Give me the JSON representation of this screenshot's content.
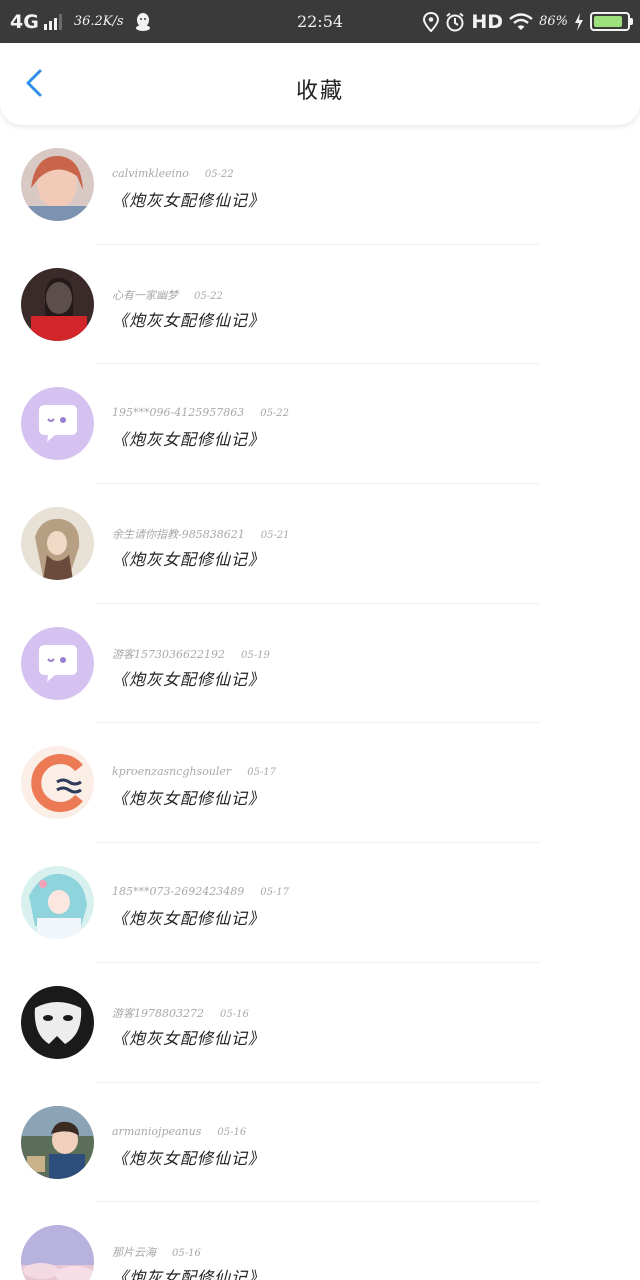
{
  "status_bar": {
    "network": "4G",
    "speed": "36.2K/s",
    "time": "22:54",
    "hd": "HD",
    "battery_percent": "86%",
    "battery_level": 0.86,
    "icons": [
      "signal-icon",
      "qq-icon",
      "location-icon",
      "alarm-icon",
      "wifi-icon",
      "charging-icon",
      "battery-icon"
    ]
  },
  "header": {
    "title": "收藏",
    "back_icon": "chevron-left-icon",
    "accent_color": "#2f8fe6"
  },
  "items": [
    {
      "user": "calvimkleeino",
      "date": "05-22",
      "title": "《炮灰女配修仙记》",
      "avatar": "photo-girl-1"
    },
    {
      "user": "心有一家幽梦",
      "date": "05-22",
      "title": "《炮灰女配修仙记》",
      "avatar": "photo-girl-2"
    },
    {
      "user": "195***096-4125957863",
      "date": "05-22",
      "title": "《炮灰女配修仙记》",
      "avatar": "default-chat-avatar"
    },
    {
      "user": "余生请你指教-985838621",
      "date": "05-21",
      "title": "《炮灰女配修仙记》",
      "avatar": "photo-girl-3"
    },
    {
      "user": "游客1573036622192",
      "date": "05-19",
      "title": "《炮灰女配修仙记》",
      "avatar": "default-chat-avatar"
    },
    {
      "user": "kproenzasncghsouler",
      "date": "05-17",
      "title": "《炮灰女配修仙记》",
      "avatar": "logo-avatar"
    },
    {
      "user": "185***073-2692423489",
      "date": "05-17",
      "title": "《炮灰女配修仙记》",
      "avatar": "anime-avatar"
    },
    {
      "user": "游客1978803272",
      "date": "05-16",
      "title": "《炮灰女配修仙记》",
      "avatar": "mask-avatar"
    },
    {
      "user": "armaniojpeanus",
      "date": "05-16",
      "title": "《炮灰女配修仙记》",
      "avatar": "photo-child"
    },
    {
      "user": "那片云海",
      "date": "05-16",
      "title": "《炮灰女配修仙记》",
      "avatar": "sky-avatar"
    }
  ]
}
